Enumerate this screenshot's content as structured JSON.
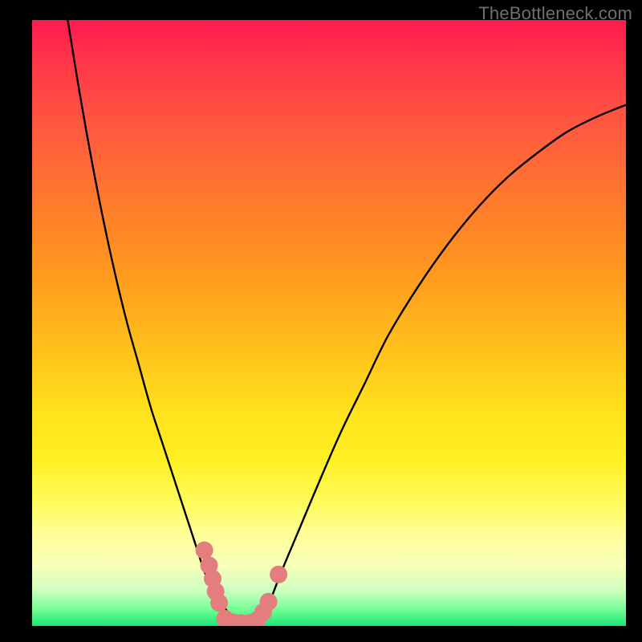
{
  "watermark": "TheBottleneck.com",
  "chart_data": {
    "type": "line",
    "title": "",
    "xlabel": "",
    "ylabel": "",
    "xlim": [
      0,
      100
    ],
    "ylim": [
      0,
      100
    ],
    "series": [
      {
        "name": "left-branch",
        "x": [
          6,
          8,
          10,
          12,
          14,
          16,
          18,
          20,
          22,
          24,
          26,
          27,
          28,
          29,
          30,
          31,
          32,
          33,
          34
        ],
        "values": [
          100,
          88,
          77,
          67,
          58,
          50,
          43,
          36,
          30,
          24,
          18,
          15,
          12,
          9,
          7,
          5,
          3.5,
          2.2,
          0
        ]
      },
      {
        "name": "right-branch",
        "x": [
          38,
          40,
          42,
          45,
          48,
          52,
          56,
          60,
          65,
          70,
          75,
          80,
          85,
          90,
          95,
          100
        ],
        "values": [
          0,
          4,
          9,
          16,
          23,
          32,
          40,
          48,
          56,
          63,
          69,
          74,
          78,
          81.5,
          84,
          86
        ]
      },
      {
        "name": "floor",
        "x": [
          34,
          36,
          38
        ],
        "values": [
          0,
          0,
          0
        ]
      }
    ],
    "markers": {
      "name": "highlight-points",
      "color": "#e47d7d",
      "radius_px": 11,
      "points": [
        {
          "x": 29.0,
          "y": 12.5
        },
        {
          "x": 29.8,
          "y": 10.0
        },
        {
          "x": 30.4,
          "y": 7.8
        },
        {
          "x": 30.9,
          "y": 5.7
        },
        {
          "x": 31.5,
          "y": 3.8
        },
        {
          "x": 32.5,
          "y": 1.2
        },
        {
          "x": 33.8,
          "y": 0.6
        },
        {
          "x": 35.2,
          "y": 0.5
        },
        {
          "x": 36.6,
          "y": 0.5
        },
        {
          "x": 37.9,
          "y": 1.0
        },
        {
          "x": 38.9,
          "y": 2.3
        },
        {
          "x": 39.8,
          "y": 4.0
        },
        {
          "x": 41.5,
          "y": 8.5
        }
      ]
    },
    "background_gradient": {
      "top": "#ff1a4f",
      "mid": "#ffe01c",
      "bottom": "#18e874"
    }
  }
}
